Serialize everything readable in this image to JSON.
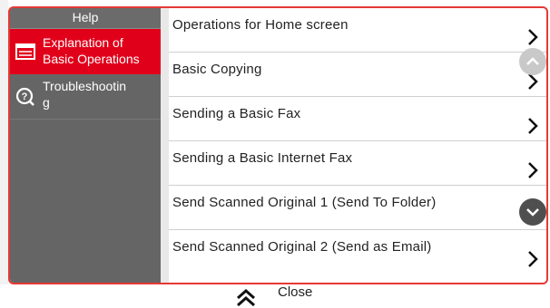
{
  "sidebar": {
    "title": "Help",
    "items": [
      {
        "label": "Explanation of\nBasic Operations",
        "icon": "book-icon",
        "active": true
      },
      {
        "label": "Troubleshootin\ng",
        "icon": "question-icon",
        "active": false
      }
    ]
  },
  "list": {
    "items": [
      {
        "label": "Operations for Home screen"
      },
      {
        "label": "Basic Copying"
      },
      {
        "label": "Sending a Basic Fax"
      },
      {
        "label": "Sending a Basic Internet Fax"
      },
      {
        "label": "Send Scanned Original 1 (Send To Folder)"
      },
      {
        "label": "Send Scanned Original 2 (Send as Email)"
      }
    ]
  },
  "footer": {
    "close_label": "Close"
  },
  "colors": {
    "accent": "#e1001a",
    "sidebar_bg": "#656565",
    "frame_border": "#e53935"
  }
}
